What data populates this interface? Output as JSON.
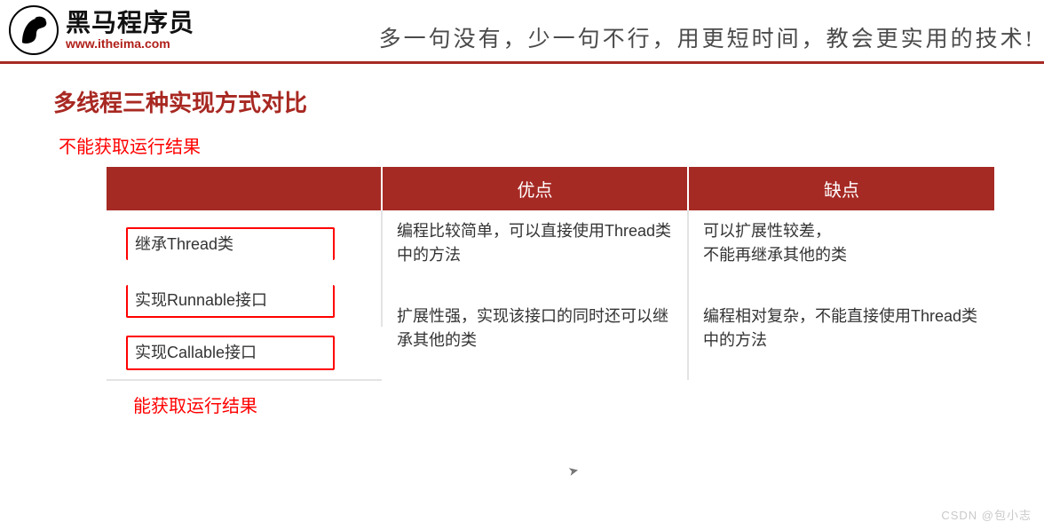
{
  "header": {
    "logo_cn": "黑马程序员",
    "logo_url": "www.itheima.com",
    "slogan": "多一句没有，少一句不行，用更短时间，教会更实用的技术!"
  },
  "title": "多线程三种实现方式对比",
  "annotations": {
    "top": "不能获取运行结果",
    "bottom": "能获取运行结果"
  },
  "table": {
    "headers": [
      "",
      "优点",
      "缺点"
    ],
    "rows": [
      {
        "label": "继承Thread类",
        "pro": "编程比较简单，可以直接使用Thread类中的方法",
        "con": "可以扩展性较差，\n不能再继承其他的类"
      },
      {
        "label": "实现Runnable接口",
        "pro": "扩展性强，实现该接口的同时还可以继承其他的类",
        "con": "编程相对复杂，不能直接使用Thread类中的方法"
      },
      {
        "label": "实现Callable接口",
        "pro": "",
        "con": ""
      }
    ]
  },
  "watermark": "CSDN @包小志",
  "chart_data": {
    "type": "table",
    "title": "多线程三种实现方式对比",
    "columns": [
      "",
      "优点",
      "缺点"
    ],
    "data": [
      [
        "继承Thread类",
        "编程比较简单，可以直接使用Thread类中的方法",
        "可以扩展性较差，不能再继承其他的类"
      ],
      [
        "实现Runnable接口",
        "扩展性强，实现该接口的同时还可以继承其他的类",
        "编程相对复杂，不能直接使用Thread类中的方法"
      ],
      [
        "实现Callable接口",
        "扩展性强，实现该接口的同时还可以继承其他的类",
        "编程相对复杂，不能直接使用Thread类中的方法"
      ]
    ],
    "annotations": {
      "继承Thread类 + 实现Runnable接口": "不能获取运行结果",
      "实现Callable接口": "能获取运行结果"
    }
  }
}
